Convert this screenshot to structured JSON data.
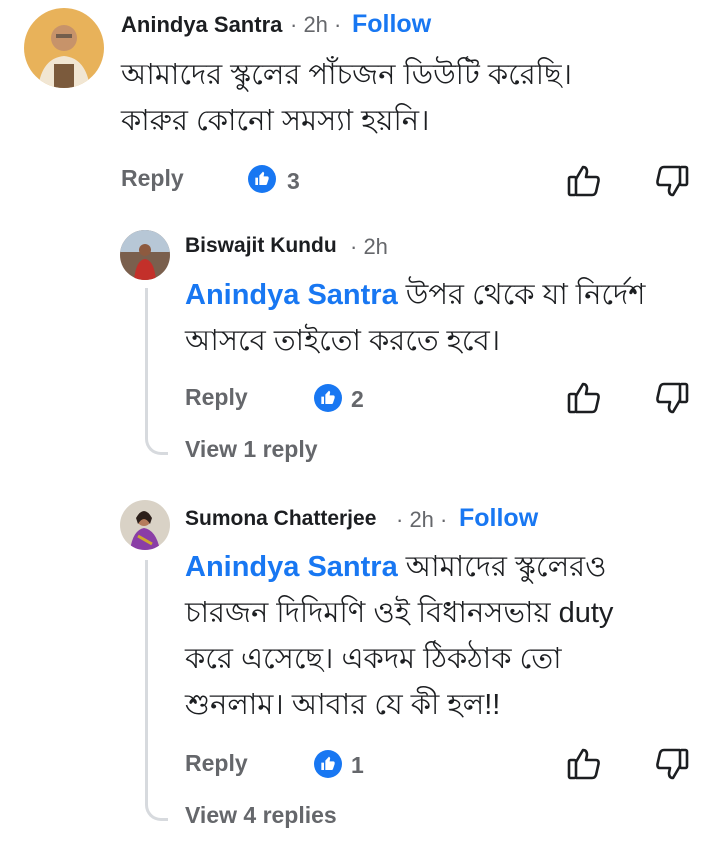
{
  "comments": [
    {
      "author": "Anindya Santra",
      "time": "· 2h ·",
      "follow": "Follow",
      "text": "আমাদের স্কুলের পাঁচজন ডিউটি করেছি।",
      "text2": "কারুর কোনো সমস্যা হয়নি।",
      "reply_label": "Reply",
      "likes": "3"
    },
    {
      "author": "Biswajit Kundu",
      "time": "· 2h",
      "mention": "Anindya Santra",
      "text": "উপর থেকে যা নির্দেশ",
      "text2": "আসবে তাইতো করতে হবে।",
      "reply_label": "Reply",
      "likes": "2",
      "view_replies": "View 1 reply"
    },
    {
      "author": "Sumona Chatterjee",
      "time": "· 2h ·",
      "follow": "Follow",
      "mention": "Anindya Santra",
      "text": "আমাদের স্কুলেরও",
      "text2": "চারজন দিদিমণি ওই বিধানসভায় duty",
      "text3": "করে এসেছে। একদম ঠিকঠাক তো",
      "text4": "শুনলাম। আবার যে কী হল!!",
      "reply_label": "Reply",
      "likes": "1",
      "view_replies": "View 4 replies"
    }
  ],
  "icons": {
    "like": "thumbs-up-outline-icon",
    "dislike": "thumbs-down-outline-icon",
    "reaction": "like-reaction-icon"
  },
  "colors": {
    "accent": "#1877f2",
    "secondary_text": "#65676b"
  }
}
